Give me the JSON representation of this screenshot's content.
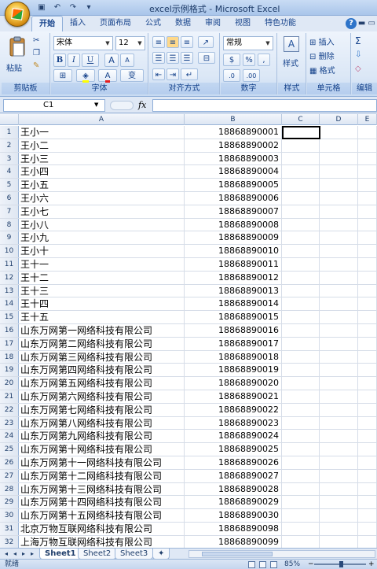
{
  "window": {
    "title": "excel示例格式 - Microsoft Excel",
    "qat_icons": [
      "save-icon",
      "undo-icon",
      "redo-icon",
      "customize-icon"
    ]
  },
  "ribbon": {
    "tabs": [
      {
        "label": "开始",
        "active": true
      },
      {
        "label": "插入"
      },
      {
        "label": "页面布局"
      },
      {
        "label": "公式"
      },
      {
        "label": "数据"
      },
      {
        "label": "审阅"
      },
      {
        "label": "视图"
      },
      {
        "label": "特色功能"
      }
    ],
    "clipboard": {
      "label": "剪贴板",
      "paste": "粘贴"
    },
    "font": {
      "label": "字体",
      "name": "宋体",
      "size": "12",
      "bold": "B",
      "italic": "I",
      "underline": "U",
      "grow": "A",
      "shrink": "A",
      "wen": "变"
    },
    "alignment": {
      "label": "对齐方式"
    },
    "number": {
      "label": "数字",
      "format": "常规",
      "percent": "%",
      "comma": ","
    },
    "styles": {
      "label": "样式",
      "btn": "样式"
    },
    "cells": {
      "label": "单元格",
      "insert": "插入",
      "delete": "删除",
      "format": "格式"
    },
    "editing": {
      "label": "编辑",
      "sum": "Σ"
    }
  },
  "formula_bar": {
    "cell_ref": "C1",
    "fx": "fx",
    "content": ""
  },
  "grid": {
    "columns": [
      "A",
      "B",
      "C",
      "D",
      "E"
    ],
    "rows": [
      {
        "n": "1",
        "a": "王小一",
        "b": "18868890001"
      },
      {
        "n": "2",
        "a": "王小二",
        "b": "18868890002"
      },
      {
        "n": "3",
        "a": "王小三",
        "b": "18868890003"
      },
      {
        "n": "4",
        "a": "王小四",
        "b": "18868890004"
      },
      {
        "n": "5",
        "a": "王小五",
        "b": "18868890005"
      },
      {
        "n": "6",
        "a": "王小六",
        "b": "18868890006"
      },
      {
        "n": "7",
        "a": "王小七",
        "b": "18868890007"
      },
      {
        "n": "8",
        "a": "王小八",
        "b": "18868890008"
      },
      {
        "n": "9",
        "a": "王小九",
        "b": "18868890009"
      },
      {
        "n": "10",
        "a": "王小十",
        "b": "18868890010"
      },
      {
        "n": "11",
        "a": "王十一",
        "b": "18868890011"
      },
      {
        "n": "12",
        "a": "王十二",
        "b": "18868890012"
      },
      {
        "n": "13",
        "a": "王十三",
        "b": "18868890013"
      },
      {
        "n": "14",
        "a": "王十四",
        "b": "18868890014"
      },
      {
        "n": "15",
        "a": "王十五",
        "b": "18868890015"
      },
      {
        "n": "16",
        "a": "山东万网第一网络科技有限公司",
        "b": "18868890016"
      },
      {
        "n": "17",
        "a": "山东万网第二网络科技有限公司",
        "b": "18868890017"
      },
      {
        "n": "18",
        "a": "山东万网第三网络科技有限公司",
        "b": "18868890018"
      },
      {
        "n": "19",
        "a": "山东万网第四网络科技有限公司",
        "b": "18868890019"
      },
      {
        "n": "20",
        "a": "山东万网第五网络科技有限公司",
        "b": "18868890020"
      },
      {
        "n": "21",
        "a": "山东万网第六网络科技有限公司",
        "b": "18868890021"
      },
      {
        "n": "22",
        "a": "山东万网第七网络科技有限公司",
        "b": "18868890022"
      },
      {
        "n": "23",
        "a": "山东万网第八网络科技有限公司",
        "b": "18868890023"
      },
      {
        "n": "24",
        "a": "山东万网第九网络科技有限公司",
        "b": "18868890024"
      },
      {
        "n": "25",
        "a": "山东万网第十网络科技有限公司",
        "b": "18868890025"
      },
      {
        "n": "26",
        "a": "山东万网第十一网络科技有限公司",
        "b": "18868890026"
      },
      {
        "n": "27",
        "a": "山东万网第十二网络科技有限公司",
        "b": "18868890027"
      },
      {
        "n": "28",
        "a": "山东万网第十三网络科技有限公司",
        "b": "18868890028"
      },
      {
        "n": "29",
        "a": "山东万网第十四网络科技有限公司",
        "b": "18868890029"
      },
      {
        "n": "30",
        "a": "山东万网第十五网络科技有限公司",
        "b": "18868890030"
      },
      {
        "n": "31",
        "a": "北京万物互联网络科技有限公司",
        "b": "18868890098"
      },
      {
        "n": "32",
        "a": "上海万物互联网络科技有限公司",
        "b": "18868890099"
      }
    ]
  },
  "sheets": [
    {
      "label": "Sheet1",
      "active": true
    },
    {
      "label": "Sheet2"
    },
    {
      "label": "Sheet3"
    }
  ],
  "status": {
    "text": "就绪",
    "zoom": "85%"
  }
}
